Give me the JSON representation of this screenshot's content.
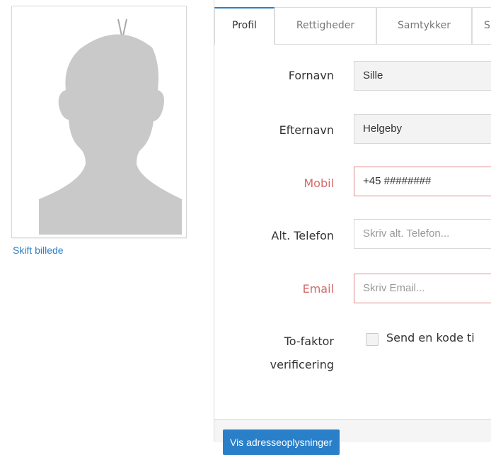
{
  "avatar": {
    "change_photo_label": "Skift billede"
  },
  "tabs": [
    {
      "label": "Profil",
      "active": true
    },
    {
      "label": "Rettigheder",
      "active": false
    },
    {
      "label": "Samtykker",
      "active": false
    },
    {
      "label": "S",
      "active": false
    }
  ],
  "form": {
    "first_name": {
      "label": "Fornavn",
      "value": "Sille"
    },
    "last_name": {
      "label": "Efternavn",
      "value": "Helgeby"
    },
    "mobile": {
      "label": "Mobil",
      "value": "+45 ########"
    },
    "alt_phone": {
      "label": "Alt. Telefon",
      "placeholder": "Skriv alt. Telefon..."
    },
    "email": {
      "label": "Email",
      "placeholder": "Skriv Email..."
    },
    "two_factor": {
      "label_line1": "To-faktor",
      "label_line2": "verificering",
      "checkbox_label": "Send en kode ti"
    }
  },
  "footer": {
    "address_button": "Vis adresseoplysninger"
  },
  "colors": {
    "accent": "#2a7fc9",
    "required": "#d46a6a",
    "error_border": "#e08a8a"
  }
}
